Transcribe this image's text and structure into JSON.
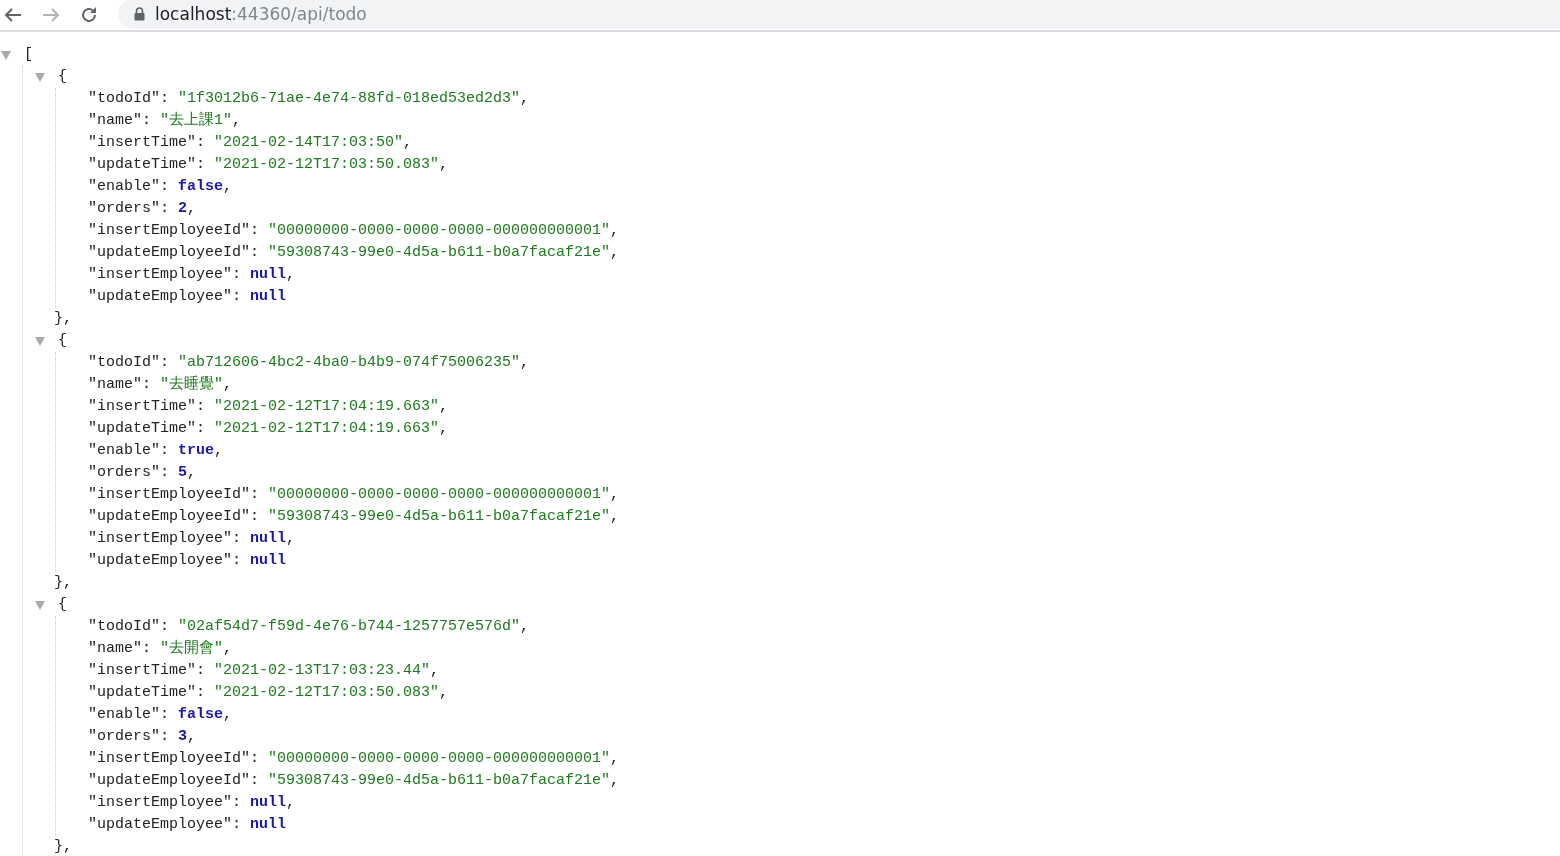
{
  "browser": {
    "url_host": "localhost",
    "url_path": ":44360/api/todo"
  },
  "json": {
    "open": "[",
    "expanded": true,
    "items": [
      {
        "open": "{",
        "expanded": true,
        "close": "},",
        "fields": [
          {
            "key": "\"todoId\"",
            "colon": ": ",
            "value": "\"1f3012b6-71ae-4e74-88fd-018ed53ed2d3\"",
            "kind": "string",
            "comma": ","
          },
          {
            "key": "\"name\"",
            "colon": ": ",
            "value": "\"去上課1\"",
            "kind": "string",
            "comma": ","
          },
          {
            "key": "\"insertTime\"",
            "colon": ": ",
            "value": "\"2021-02-14T17:03:50\"",
            "kind": "string",
            "comma": ","
          },
          {
            "key": "\"updateTime\"",
            "colon": ": ",
            "value": "\"2021-02-12T17:03:50.083\"",
            "kind": "string",
            "comma": ","
          },
          {
            "key": "\"enable\"",
            "colon": ": ",
            "value": "false",
            "kind": "keyword",
            "comma": ","
          },
          {
            "key": "\"orders\"",
            "colon": ": ",
            "value": "2",
            "kind": "number",
            "comma": ","
          },
          {
            "key": "\"insertEmployeeId\"",
            "colon": ": ",
            "value": "\"00000000-0000-0000-0000-000000000001\"",
            "kind": "string",
            "comma": ","
          },
          {
            "key": "\"updateEmployeeId\"",
            "colon": ": ",
            "value": "\"59308743-99e0-4d5a-b611-b0a7facaf21e\"",
            "kind": "string",
            "comma": ","
          },
          {
            "key": "\"insertEmployee\"",
            "colon": ": ",
            "value": "null",
            "kind": "keyword",
            "comma": ","
          },
          {
            "key": "\"updateEmployee\"",
            "colon": ": ",
            "value": "null",
            "kind": "keyword"
          }
        ]
      },
      {
        "open": "{",
        "expanded": true,
        "close": "},",
        "fields": [
          {
            "key": "\"todoId\"",
            "colon": ": ",
            "value": "\"ab712606-4bc2-4ba0-b4b9-074f75006235\"",
            "kind": "string",
            "comma": ","
          },
          {
            "key": "\"name\"",
            "colon": ": ",
            "value": "\"去睡覺\"",
            "kind": "string",
            "comma": ","
          },
          {
            "key": "\"insertTime\"",
            "colon": ": ",
            "value": "\"2021-02-12T17:04:19.663\"",
            "kind": "string",
            "comma": ","
          },
          {
            "key": "\"updateTime\"",
            "colon": ": ",
            "value": "\"2021-02-12T17:04:19.663\"",
            "kind": "string",
            "comma": ","
          },
          {
            "key": "\"enable\"",
            "colon": ": ",
            "value": "true",
            "kind": "keyword",
            "comma": ","
          },
          {
            "key": "\"orders\"",
            "colon": ": ",
            "value": "5",
            "kind": "number",
            "comma": ","
          },
          {
            "key": "\"insertEmployeeId\"",
            "colon": ": ",
            "value": "\"00000000-0000-0000-0000-000000000001\"",
            "kind": "string",
            "comma": ","
          },
          {
            "key": "\"updateEmployeeId\"",
            "colon": ": ",
            "value": "\"59308743-99e0-4d5a-b611-b0a7facaf21e\"",
            "kind": "string",
            "comma": ","
          },
          {
            "key": "\"insertEmployee\"",
            "colon": ": ",
            "value": "null",
            "kind": "keyword",
            "comma": ","
          },
          {
            "key": "\"updateEmployee\"",
            "colon": ": ",
            "value": "null",
            "kind": "keyword"
          }
        ]
      },
      {
        "open": "{",
        "expanded": true,
        "close": "},",
        "fields": [
          {
            "key": "\"todoId\"",
            "colon": ": ",
            "value": "\"02af54d7-f59d-4e76-b744-1257757e576d\"",
            "kind": "string",
            "comma": ","
          },
          {
            "key": "\"name\"",
            "colon": ": ",
            "value": "\"去開會\"",
            "kind": "string",
            "comma": ","
          },
          {
            "key": "\"insertTime\"",
            "colon": ": ",
            "value": "\"2021-02-13T17:03:23.44\"",
            "kind": "string",
            "comma": ","
          },
          {
            "key": "\"updateTime\"",
            "colon": ": ",
            "value": "\"2021-02-12T17:03:50.083\"",
            "kind": "string",
            "comma": ","
          },
          {
            "key": "\"enable\"",
            "colon": ": ",
            "value": "false",
            "kind": "keyword",
            "comma": ","
          },
          {
            "key": "\"orders\"",
            "colon": ": ",
            "value": "3",
            "kind": "number",
            "comma": ","
          },
          {
            "key": "\"insertEmployeeId\"",
            "colon": ": ",
            "value": "\"00000000-0000-0000-0000-000000000001\"",
            "kind": "string",
            "comma": ","
          },
          {
            "key": "\"updateEmployeeId\"",
            "colon": ": ",
            "value": "\"59308743-99e0-4d5a-b611-b0a7facaf21e\"",
            "kind": "string",
            "comma": ","
          },
          {
            "key": "\"insertEmployee\"",
            "colon": ": ",
            "value": "null",
            "kind": "keyword",
            "comma": ","
          },
          {
            "key": "\"updateEmployee\"",
            "colon": ": ",
            "value": "null",
            "kind": "keyword"
          }
        ]
      }
    ]
  }
}
